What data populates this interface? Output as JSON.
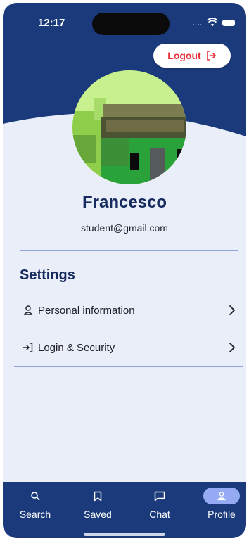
{
  "status_bar": {
    "time": "12:17",
    "signal": "...."
  },
  "header": {
    "logout_label": "Logout"
  },
  "profile": {
    "name": "Francesco",
    "email": "student@gmail.com"
  },
  "settings": {
    "title": "Settings",
    "items": [
      {
        "label": "Personal information",
        "icon": "user-icon"
      },
      {
        "label": "Login & Security",
        "icon": "login-icon"
      }
    ]
  },
  "bottom_nav": {
    "items": [
      {
        "label": "Search",
        "icon": "search-icon"
      },
      {
        "label": "Saved",
        "icon": "bookmark-icon"
      },
      {
        "label": "Chat",
        "icon": "chat-icon"
      },
      {
        "label": "Profile",
        "icon": "profile-icon",
        "active": true
      }
    ]
  },
  "colors": {
    "header": "#1a3a7b",
    "background": "#e9eef9",
    "accent": "#94abf3",
    "logout": "#e8323b",
    "title": "#172b5e"
  }
}
